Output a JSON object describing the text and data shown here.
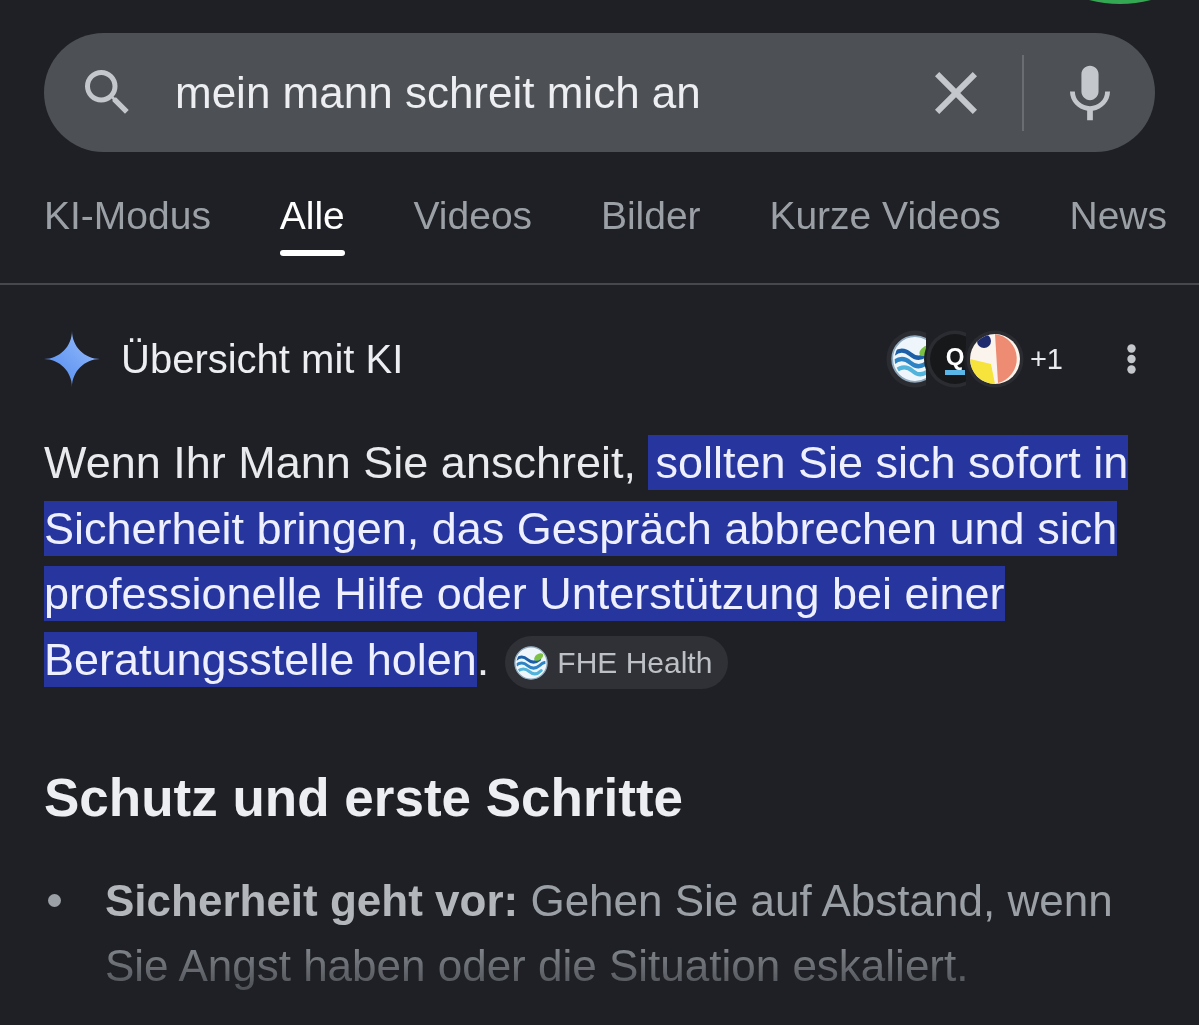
{
  "search": {
    "value": "mein mann schreit mich an"
  },
  "tabs": [
    {
      "label": "KI-Modus",
      "selected": false
    },
    {
      "label": "Alle",
      "selected": true
    },
    {
      "label": "Videos",
      "selected": false
    },
    {
      "label": "Bilder",
      "selected": false
    },
    {
      "label": "Kurze Videos",
      "selected": false
    },
    {
      "label": "News",
      "selected": false
    }
  ],
  "ai_overview": {
    "title": "Übersicht mit KI",
    "sources": [
      {
        "kind": "waves"
      },
      {
        "kind": "letter",
        "letter": "Q"
      },
      {
        "kind": "circles"
      }
    ],
    "more_sources": "+1",
    "paragraph": {
      "segments": [
        {
          "text": "Wenn Ihr Mann Sie anschreit, ",
          "highlighted": false
        },
        {
          "text": "sollten Sie sich sofort in Sicherheit bringen, das Gespräch abbrechen und sich professionelle Hilfe oder Unterstützung bei einer Beratungsstelle holen",
          "highlighted": true
        },
        {
          "text": ".",
          "highlighted": false
        }
      ],
      "source_chip": {
        "kind": "waves",
        "label": "FHE Health"
      }
    },
    "heading": "Schutz und erste Schritte",
    "bullets": [
      "**Sicherheit geht vor:** Gehen Sie auf Abstand, wenn Sie Angst haben oder die Situation eskaliert."
    ]
  }
}
